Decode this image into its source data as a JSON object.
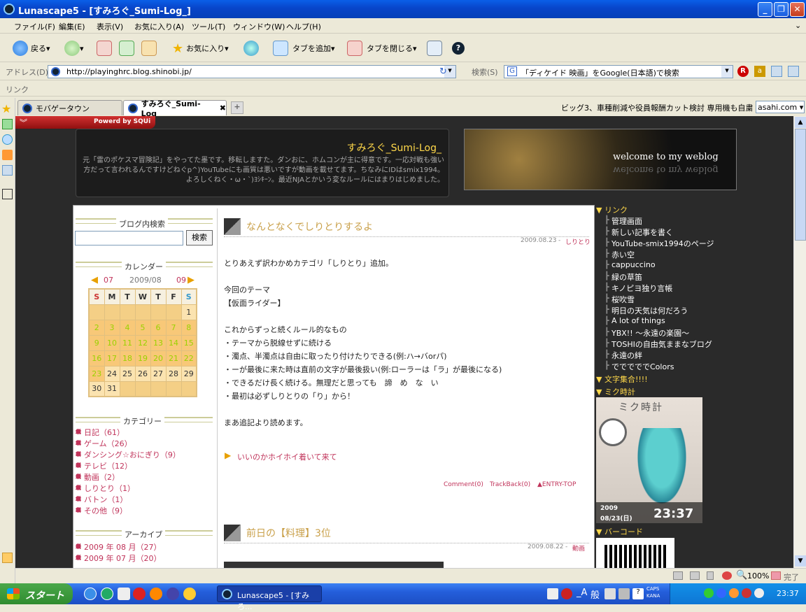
{
  "window": {
    "title": "Lunascape5 - [すみろぐ_Sumi-Log_]"
  },
  "menu": [
    "ファイル(F)",
    "編集(E)",
    "表示(V)",
    "お気に入り(A)",
    "ツール(T)",
    "ウィンドウ(W)",
    "ヘルプ(H)"
  ],
  "toolbar": {
    "back": "戻る",
    "favorites": "お気に入り",
    "add_tab": "タブを追加",
    "close_tab": "タブを閉じる"
  },
  "address": {
    "label": "アドレス(D)",
    "url": "http://playinghrc.blog.shinobi.jp/",
    "search_label": "検索(S)",
    "search_value": "「ディケイド 映画」をGoogle(日本語)で検索",
    "links_label": "リンク"
  },
  "tabs": [
    {
      "label": "モバゲータウン"
    },
    {
      "label": "すみろぐ_Sumi-Log_"
    }
  ],
  "news": {
    "text": "ビッグ3、車種削減や役員報酬カット検討 専用機も自粛",
    "source": "asahi.com"
  },
  "ad": {
    "text": "Powerd by SQUi"
  },
  "blog": {
    "title": "すみろぐ_Sumi-Log_",
    "description": "元「雷のポケスマ冒険記」をやってた墨です。移転しますた。ダンおに、ホムコンが主に得意です。一応対戦も強い方だって言われるんですけどねぐp^)YouTubeにも画質は悪いですが動画を載せてます。ちなみにIDはsmix1994。よろしくねく・ω・`)ﾖｼｷｰﾝ。最近NJAとかいう変なルールにはまりはじめました。",
    "banner": "welcome to my weblog"
  },
  "sidebar_left": {
    "search_heading": "ブログ内検索",
    "search_button": "検索",
    "calendar_heading": "カレンダー",
    "cal_prev": "07",
    "cal_month": "2009/08",
    "cal_next": "09",
    "cal_days": [
      "S",
      "M",
      "T",
      "W",
      "T",
      "F",
      "S"
    ],
    "cal_rows": [
      [
        "",
        "",
        "",
        "",
        "",
        "",
        "1"
      ],
      [
        "2",
        "3",
        "4",
        "5",
        "6",
        "7",
        "8"
      ],
      [
        "9",
        "10",
        "11",
        "12",
        "13",
        "14",
        "15"
      ],
      [
        "16",
        "17",
        "18",
        "19",
        "20",
        "21",
        "22"
      ],
      [
        "23",
        "24",
        "25",
        "26",
        "27",
        "28",
        "29"
      ],
      [
        "30",
        "31",
        "",
        "",
        "",
        "",
        ""
      ]
    ],
    "category_heading": "カテゴリー",
    "categories": [
      "日記（61）",
      "ゲーム（26）",
      "ダンシング☆おにぎり（9）",
      "テレビ（12）",
      "動画（2）",
      "しりとり（1）",
      "バトン（1）",
      "その他（9）"
    ],
    "archive_heading": "アーカイブ",
    "archives": [
      "2009 年 08 月（27）",
      "2009 年 07 月（20）"
    ]
  },
  "entry1": {
    "title": "なんとなくでしりとりするよ",
    "date": "2009.08.23",
    "category": "しりとり",
    "lines": [
      "とりあえず訳わかめカテゴリ「しりとり」追加。",
      "",
      "今回のテーマ",
      "【仮面ライダー】",
      "",
      "これからずっと続くルール的なもの",
      "・テーマから脱線せずに続ける",
      "・濁点、半濁点は自由に取ったり付けたりできる(例:ハ→バorパ)",
      "・ーが最後に来た時は直前の文字が最後扱い(例:ローラーは「ラ」が最後になる)",
      "・できるだけ長く続ける。無理だと思っても　諦　め　な　い",
      "・最初は必ずしりとりの「り」から！",
      "",
      "まあ追記より読めます。"
    ],
    "more": "いいのかホイホイ着いて来て",
    "footer": [
      "Comment(0)",
      "TrackBack(0)",
      "▲ENTRY-TOP"
    ]
  },
  "entry2": {
    "title": "前日の【料理】3位",
    "date": "2009.08.22",
    "category": "動画"
  },
  "sidebar_right": {
    "link_heading": "リンク",
    "links": [
      "管理画面",
      "新しい記事を書く",
      "YouTube-smix1994のページ",
      "赤い空",
      "cappuccino",
      "緑の草笛",
      "キノピヨ独り言帳",
      "桜吹雪",
      "明日の天気は何だろう",
      "A lot of things",
      "YBX!! ～永遠の楽園～",
      "TOSHIの自由気ままなブログ",
      "永遠の絆",
      "でででででColors"
    ],
    "moji_heading": "文字集合!!!!",
    "miku_heading": "ミク時計",
    "miku_title": "ミク時計",
    "miku_year": "2009",
    "miku_date": "08/23(日)",
    "miku_time": "23:37",
    "barcode_heading": "バーコード"
  },
  "status": {
    "zoom": "100%",
    "done": "完了"
  },
  "taskbar": {
    "start": "スタート",
    "task": "Lunascape5 - [すみろ...",
    "time": "23:37",
    "caps": "CAPS",
    "kana": "KANA",
    "ime": "般"
  }
}
